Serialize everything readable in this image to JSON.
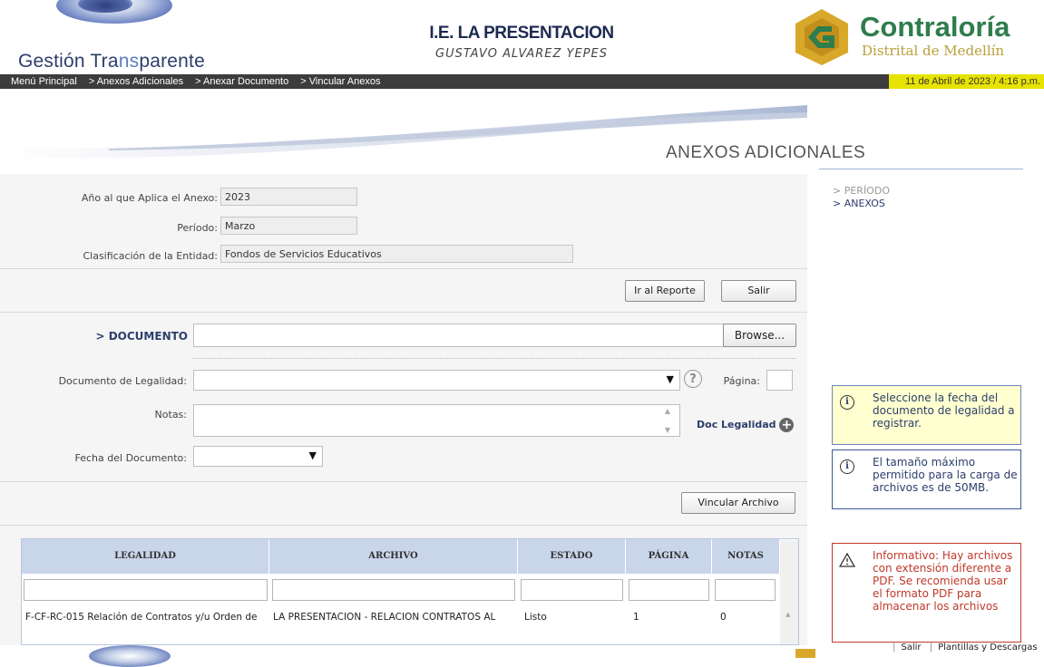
{
  "header": {
    "brand_part1": "Gestión Tra",
    "brand_part2": "ns",
    "brand_part3": "parente",
    "institution": "I.E. LA PRESENTACION",
    "rector": "GUSTAVO ALVAREZ YEPES",
    "org_name": "Contraloría",
    "org_sub": "Distrital de Medellín"
  },
  "nav": {
    "items": [
      "Menú Principal",
      "> Anexos Adicionales",
      "> Anexar Documento",
      "> Vincular Anexos"
    ],
    "date": "11 de Abril de 2023 / 4:16 p.m."
  },
  "page": {
    "title": "ANEXOS ADICIONALES"
  },
  "steps": {
    "items": [
      "> PERÍODO",
      "> ANEXOS"
    ]
  },
  "form": {
    "year_label": "Año al que Aplica el Anexo:",
    "year_value": "2023",
    "period_label": "Período:",
    "period_value": "Marzo",
    "class_label": "Clasificación de la Entidad:",
    "class_value": "Fondos de Servicios Educativos",
    "report_button": "Ir al Reporte",
    "exit_button": "Salir",
    "document_label": "> DOCUMENTO",
    "browse_button": "Browse...",
    "legal_label": "Documento de Legalidad:",
    "help_icon": "?",
    "page_label": "Página:",
    "notes_label": "Notas:",
    "doc_legalidad_link": "Doc Legalidad",
    "date_label": "Fecha del Documento:",
    "link_button": "Vincular Archivo"
  },
  "table": {
    "columns": [
      "LEGALIDAD",
      "ARCHIVO",
      "ESTADO",
      "PÁGINA",
      "NOTAS"
    ],
    "rows": [
      [
        "F-CF-RC-015 Relación de Contratos y/u Orden de",
        "LA PRESENTACION - RELACION CONTRATOS AL",
        "Listo",
        "1",
        "0"
      ]
    ]
  },
  "info": {
    "date_hint": "Seleccione la fecha del documento de legalidad a registrar.",
    "size_hint": "El tamaño máximo permitido para la carga de archivos es de 50MB.",
    "pdf_warning": "Informativo: Hay archivos con extensión diferente a PDF. Se recomienda usar el formato PDF para almacenar los archivos"
  },
  "footer": {
    "exit_link": "Salir",
    "templates_link": "Plantillas y Descargas"
  },
  "colors": {
    "nav_bg": "#3c3c3c",
    "date_bg": "#e7e300",
    "table_header": "#c9d6ea",
    "warning": "#c0392b",
    "info_border": "#3b5998"
  }
}
